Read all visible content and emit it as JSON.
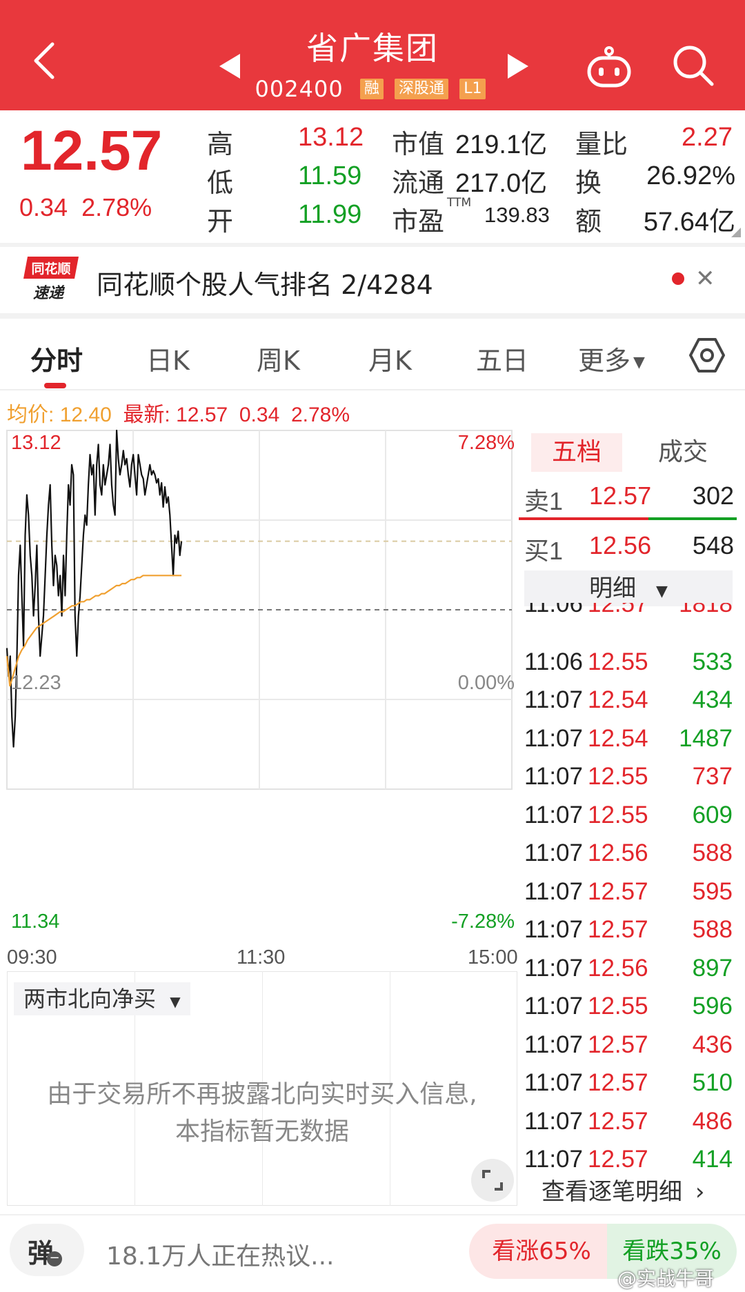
{
  "header": {
    "title": "省广集团",
    "code": "002400",
    "tags": [
      "融",
      "深股通",
      "L1"
    ]
  },
  "quote": {
    "price": "12.57",
    "change": "0.34",
    "change_pct": "2.78%",
    "high_label": "高",
    "high": "13.12",
    "low_label": "低",
    "low": "11.59",
    "open_label": "开",
    "open": "11.99",
    "mcap_label": "市值",
    "mcap": "219.1亿",
    "float_label": "流通",
    "float": "217.0亿",
    "pe_label": "市盈",
    "pe_sup": "TTM",
    "pe": "139.83",
    "vol_ratio_label": "量比",
    "vol_ratio": "2.27",
    "turnover_label": "换",
    "turnover": "26.92%",
    "amount_label": "额",
    "amount": "57.64亿"
  },
  "news": {
    "logo_line1": "同花顺",
    "logo_line2": "速递",
    "text": "同花顺个股人气排名 2/4284"
  },
  "tabs": [
    "分时",
    "日K",
    "周K",
    "月K",
    "五日",
    "更多"
  ],
  "chart": {
    "legend_avg_label": "均价:",
    "legend_avg": "12.40",
    "legend_last_label": "最新:",
    "legend_last": "12.57",
    "legend_chg": "0.34",
    "legend_pct": "2.78%",
    "y_top": "13.12",
    "y_mid": "12.23",
    "y_bottom": "11.34",
    "pct_top": "7.28%",
    "pct_mid": "0.00%",
    "pct_bottom": "-7.28%",
    "x_labels": [
      "09:30",
      "11:30",
      "15:00"
    ]
  },
  "chart_data": {
    "type": "line",
    "ylim": [
      11.34,
      13.12
    ],
    "prev_close": 12.23,
    "series": [
      {
        "values": [
          12.04,
          11.9,
          12.0,
          11.7,
          11.55,
          11.7,
          12.0,
          12.4,
          12.55,
          12.3,
          12.05,
          12.6,
          12.8,
          12.7,
          12.5,
          12.4,
          12.2,
          12.35,
          12.55,
          12.2,
          12.0,
          12.1,
          12.2,
          12.4,
          12.6,
          12.75,
          12.85,
          12.55,
          12.35,
          12.5,
          12.45,
          12.3,
          12.4,
          12.2,
          12.5,
          12.3,
          12.6,
          12.85,
          12.75,
          12.95,
          12.9,
          12.2,
          12.0,
          12.2,
          12.3,
          12.45,
          12.6,
          12.7,
          12.65,
          12.85,
          13.0,
          12.9,
          12.95,
          12.7,
          12.95,
          13.05,
          12.85,
          12.8,
          12.95,
          12.85,
          12.9,
          12.95,
          13.05,
          12.85,
          12.75,
          12.7,
          13.12,
          12.98,
          12.9,
          12.95,
          13.02,
          12.95,
          12.98,
          12.9,
          12.84,
          12.95,
          13.0,
          12.9,
          12.8,
          13.0,
          12.95,
          12.9,
          12.88,
          12.8,
          12.85,
          12.9,
          12.95,
          12.9,
          12.92,
          12.9,
          12.86,
          12.88,
          12.8,
          12.86,
          12.74,
          12.84,
          12.76,
          12.79,
          12.7,
          12.55,
          12.4,
          12.6,
          12.56,
          12.62,
          12.5,
          12.57
        ]
      },
      {
        "values": [
          12.0,
          11.85,
          11.9,
          11.95,
          12.0,
          12.03,
          12.05,
          12.08,
          12.1,
          12.12,
          12.14,
          12.15,
          12.16,
          12.17,
          12.18,
          12.19,
          12.2,
          12.21,
          12.22,
          12.22,
          12.23,
          12.24,
          12.25,
          12.25,
          12.26,
          12.27,
          12.27,
          12.28,
          12.28,
          12.29,
          12.3,
          12.3,
          12.31,
          12.31,
          12.32,
          12.33,
          12.34,
          12.35,
          12.35,
          12.36,
          12.36,
          12.37,
          12.38,
          12.38,
          12.39,
          12.39,
          12.4,
          12.4,
          12.4,
          12.4,
          12.4,
          12.4,
          12.4,
          12.4,
          12.4,
          12.4,
          12.4,
          12.4,
          12.4,
          12.4
        ]
      }
    ]
  },
  "orderbook": {
    "tab_active": "五档",
    "tab_other": "成交",
    "sell1_label": "卖1",
    "sell1_price": "12.57",
    "sell1_vol": "302",
    "buy1_label": "买1",
    "buy1_price": "12.56",
    "buy1_vol": "548",
    "detail_label": "明细",
    "more_label": "查看逐笔明细"
  },
  "ticks": [
    {
      "time": "11:06",
      "price": "12.57",
      "vol": "1818",
      "dir": "red"
    },
    {
      "time": "11:06",
      "price": "12.55",
      "vol": "533",
      "dir": "green"
    },
    {
      "time": "11:07",
      "price": "12.54",
      "vol": "434",
      "dir": "green"
    },
    {
      "time": "11:07",
      "price": "12.54",
      "vol": "1487",
      "dir": "green"
    },
    {
      "time": "11:07",
      "price": "12.55",
      "vol": "737",
      "dir": "red"
    },
    {
      "time": "11:07",
      "price": "12.55",
      "vol": "609",
      "dir": "green"
    },
    {
      "time": "11:07",
      "price": "12.56",
      "vol": "588",
      "dir": "red"
    },
    {
      "time": "11:07",
      "price": "12.57",
      "vol": "595",
      "dir": "red"
    },
    {
      "time": "11:07",
      "price": "12.57",
      "vol": "588",
      "dir": "red"
    },
    {
      "time": "11:07",
      "price": "12.56",
      "vol": "897",
      "dir": "green"
    },
    {
      "time": "11:07",
      "price": "12.55",
      "vol": "596",
      "dir": "green"
    },
    {
      "time": "11:07",
      "price": "12.57",
      "vol": "436",
      "dir": "red"
    },
    {
      "time": "11:07",
      "price": "12.57",
      "vol": "510",
      "dir": "green"
    },
    {
      "time": "11:07",
      "price": "12.57",
      "vol": "486",
      "dir": "red"
    },
    {
      "time": "11:07",
      "price": "12.57",
      "vol": "414",
      "dir": "green"
    }
  ],
  "northflow": {
    "select_label": "两市北向净买",
    "message_line1": "由于交易所不再披露北向实时买入信息,",
    "message_line2": "本指标暂无数据"
  },
  "bottom": {
    "danmu_label": "弹",
    "hot_text": "18.1万人正在热议...",
    "vote_up": "看涨65%",
    "vote_down": "看跌35%",
    "watermark": "@实战牛哥"
  },
  "colors": {
    "brand": "#e8383d",
    "up": "#e2252b",
    "down": "#13a024",
    "avg_line": "#f0a030"
  }
}
